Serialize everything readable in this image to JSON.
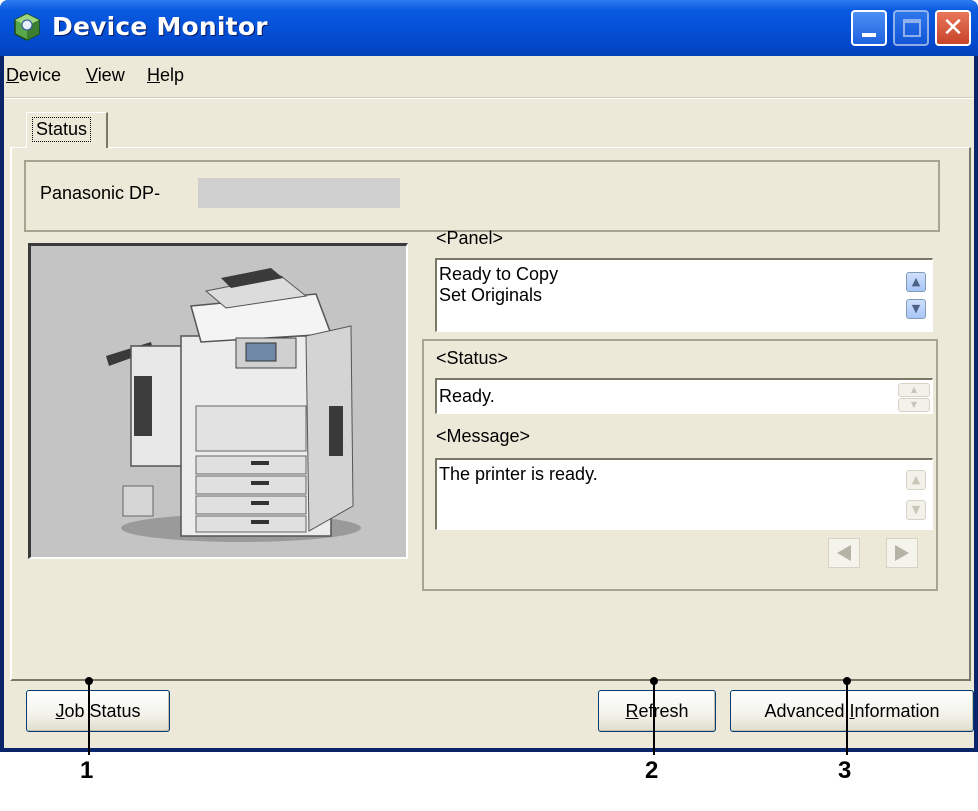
{
  "window": {
    "title": "Device Monitor",
    "icon": "device-monitor-icon",
    "controls": [
      "minimize-icon",
      "maximize-icon",
      "close-icon"
    ]
  },
  "menu": {
    "items": [
      {
        "label": "Device",
        "accel": "D",
        "rest": "evice"
      },
      {
        "label": "View",
        "accel": "V",
        "rest": "iew"
      },
      {
        "label": "Help",
        "accel": "H",
        "rest": "elp"
      }
    ]
  },
  "tabs": [
    {
      "label": "Status",
      "selected": true
    }
  ],
  "device": {
    "model_prefix": "Panasonic DP-"
  },
  "panel": {
    "heading": "<Panel>",
    "lines": [
      "Ready to Copy",
      "Set Originals"
    ]
  },
  "status": {
    "heading": "<Status>",
    "value": "Ready."
  },
  "message": {
    "heading": "<Message>",
    "value": "The printer is ready."
  },
  "buttons": {
    "job_status": {
      "accel": "J",
      "rest": "ob Status"
    },
    "refresh": {
      "accel": "R",
      "rest": "efresh"
    },
    "advanced": {
      "before": "Advanced ",
      "accel": "I",
      "rest": "nformation"
    }
  },
  "callouts": [
    "1",
    "2",
    "3"
  ],
  "colors": {
    "titlebar": "#0451d8",
    "client": "#ece9d8",
    "close_button": "#c8432a"
  }
}
